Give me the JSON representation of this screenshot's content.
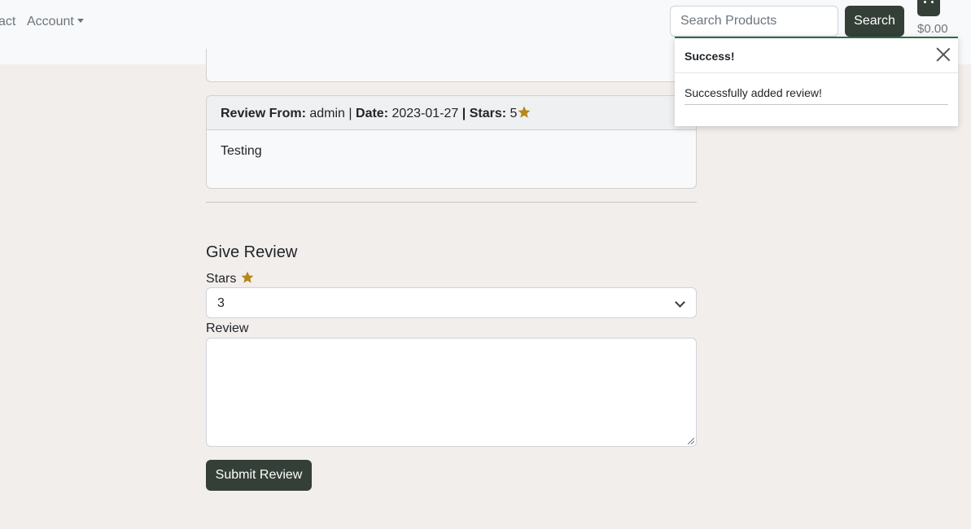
{
  "nav": {
    "contact_label": "act",
    "account_label": "Account",
    "search_placeholder": "Search Products",
    "search_button": "Search",
    "cart_total": "$0.00"
  },
  "review": {
    "from_label": "Review From:",
    "from_value": "admin",
    "date_label": "Date:",
    "date_value": "2023-01-27",
    "stars_label": "Stars:",
    "stars_value": "5",
    "sep1": "|",
    "sep2": "|",
    "body": "Testing"
  },
  "form": {
    "title": "Give Review",
    "stars_label": "Stars",
    "stars_selected": "3",
    "review_label": "Review",
    "review_value": "",
    "submit_label": "Submit Review"
  },
  "toast": {
    "title": "Success!",
    "message": "Successfully added review!"
  },
  "colors": {
    "accent": "#343f38",
    "star": "#b8861b",
    "toast_border": "#2f6b45"
  }
}
